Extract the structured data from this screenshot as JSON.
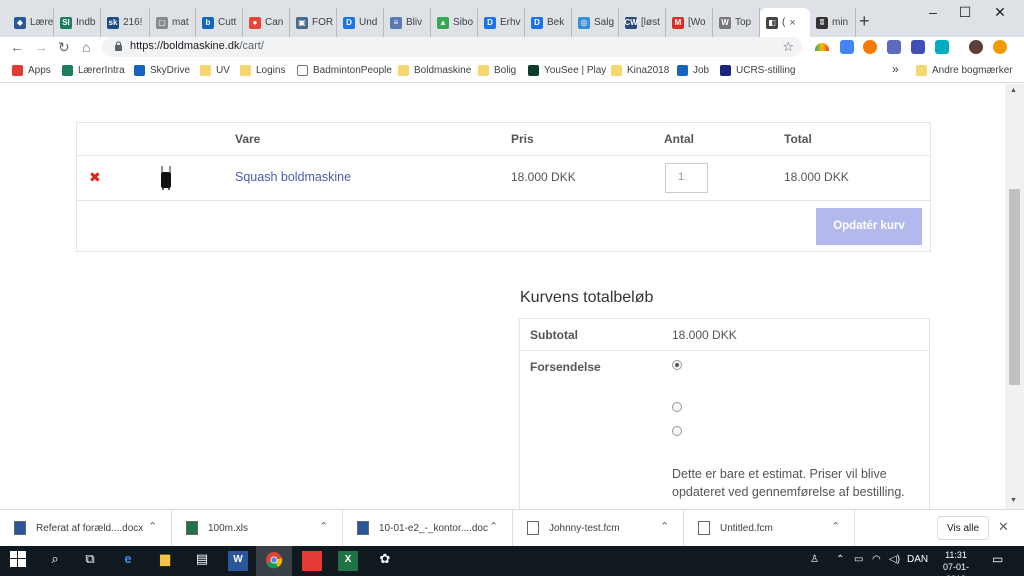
{
  "browser": {
    "tabs": [
      {
        "label": "Lære",
        "color": "#2b5797",
        "glyph": "◆"
      },
      {
        "label": "Indb",
        "color": "#1a7f5a",
        "glyph": "SI"
      },
      {
        "label": "216!",
        "color": "#1d4a80",
        "glyph": "sk"
      },
      {
        "label": "mat",
        "color": "#8a8a8a",
        "glyph": "▢"
      },
      {
        "label": "Cutt",
        "color": "#1565c0",
        "glyph": "b"
      },
      {
        "label": "Can",
        "color": "#e8453c",
        "glyph": "●"
      },
      {
        "label": "FOR",
        "color": "#4a6a8a",
        "glyph": "▣"
      },
      {
        "label": "Und",
        "color": "#1a73e8",
        "glyph": "D"
      },
      {
        "label": "Bliv",
        "color": "#5a7ab0",
        "glyph": "≡"
      },
      {
        "label": "Sibo",
        "color": "#34a853",
        "glyph": "▲"
      },
      {
        "label": "Erhv",
        "color": "#1a73e8",
        "glyph": "D"
      },
      {
        "label": "Bek",
        "color": "#1a73e8",
        "glyph": "D"
      },
      {
        "label": "Salg",
        "color": "#3b8ed8",
        "glyph": "◎"
      },
      {
        "label": "[løst",
        "color": "#2a4a7a",
        "glyph": "CW"
      },
      {
        "label": "[Wo",
        "color": "#d93025",
        "glyph": "M"
      },
      {
        "label": "Top",
        "color": "#777777",
        "glyph": "W"
      },
      {
        "label": "(",
        "color": "#444444",
        "glyph": "◧",
        "active": true,
        "close": "×"
      },
      {
        "label": "min",
        "color": "#333333",
        "glyph": "ʬ"
      }
    ],
    "new_tab": "+",
    "window_controls": [
      "–",
      "☐",
      "✕"
    ],
    "url_host": "https://boldmaskine.dk",
    "url_path": "/cart/",
    "star": "☆",
    "lock": "🔒",
    "nav": {
      "back": "←",
      "forward": "→",
      "reload": "↻",
      "home": "⌂"
    },
    "menu": "⋮"
  },
  "bookmarks": {
    "items": [
      {
        "label": "Apps",
        "kind": "apps"
      },
      {
        "label": "LærerIntra",
        "kind": "si"
      },
      {
        "label": "SkyDrive",
        "kind": "sky"
      },
      {
        "label": "UV",
        "kind": "folder"
      },
      {
        "label": "Logins",
        "kind": "folder"
      },
      {
        "label": "BadmintonPeople",
        "kind": "page"
      },
      {
        "label": "Boldmaskine",
        "kind": "folder"
      },
      {
        "label": "Bolig",
        "kind": "folder"
      },
      {
        "label": "YouSee | Play",
        "kind": "yousee"
      },
      {
        "label": "Kina2018",
        "kind": "folder"
      },
      {
        "label": "Job",
        "kind": "job"
      },
      {
        "label": "UCRS-stilling",
        "kind": "ucrs"
      }
    ],
    "overflow": "»",
    "other": "Andre bogmærker"
  },
  "cart": {
    "headers": {
      "product": "Vare",
      "price": "Pris",
      "qty": "Antal",
      "total": "Total"
    },
    "items": [
      {
        "name": "Squash boldmaskine",
        "price": "18.000 DKK",
        "qty": "1",
        "total": "18.000 DKK",
        "remove": "✖"
      }
    ],
    "update_button": "Opdatér kurv"
  },
  "totals": {
    "title": "Kurvens totalbeløb",
    "subtotal_label": "Subtotal",
    "subtotal_value": "18.000 DKK",
    "shipping_label": "Forsendelse",
    "note": "Dette er bare et estimat. Priser vil blive opdateret ved gennemførelse af bestilling."
  },
  "downloads": {
    "items": [
      {
        "name": "Referat af foræld....docx",
        "type": "word"
      },
      {
        "name": "100m.xls",
        "type": "excel"
      },
      {
        "name": "10-01-e2_-_kontor....doc",
        "type": "word"
      },
      {
        "name": "Johnny-test.fcm",
        "type": "file"
      },
      {
        "name": "Untitled.fcm",
        "type": "file"
      }
    ],
    "show_all": "Vis alle",
    "close": "✕"
  },
  "taskbar": {
    "lang": "DAN",
    "time": "11:31",
    "date": "07-01-2019"
  }
}
